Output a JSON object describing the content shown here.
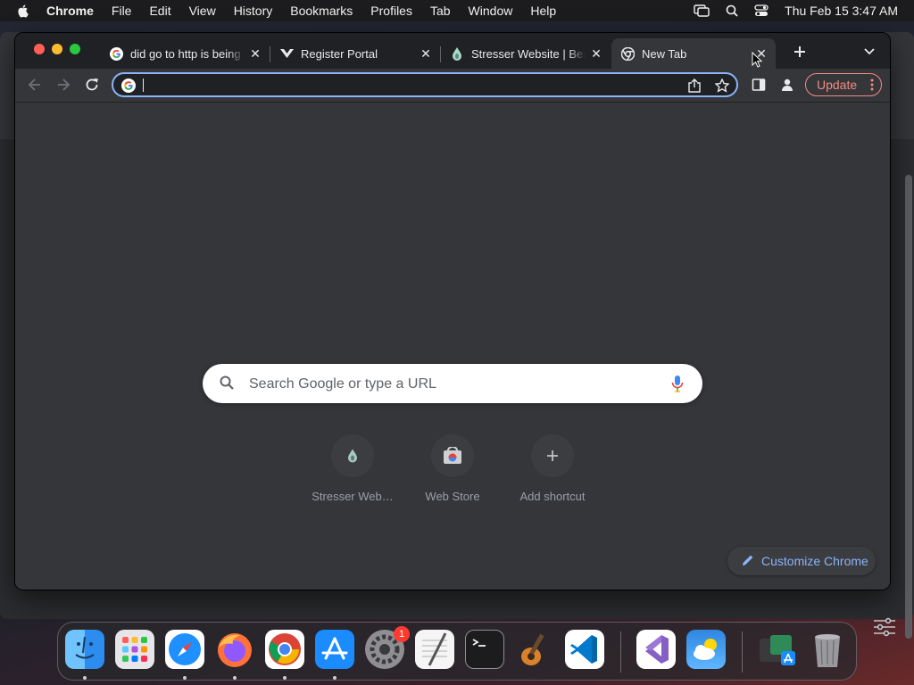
{
  "menubar": {
    "app_name": "Chrome",
    "items": [
      "File",
      "Edit",
      "View",
      "History",
      "Bookmarks",
      "Profiles",
      "Tab",
      "Window",
      "Help"
    ],
    "clock": "Thu Feb 15  3:47 AM"
  },
  "tabs": [
    {
      "title": "did go to http is being",
      "favicon": "google-icon",
      "active": false
    },
    {
      "title": "Register Portal",
      "favicon": "v-logo-icon",
      "active": false
    },
    {
      "title": "Stresser Website | Bes",
      "favicon": "droplet-icon",
      "active": false
    },
    {
      "title": "New Tab",
      "favicon": "chrome-icon",
      "active": true
    }
  ],
  "omnibox": {
    "value": "",
    "placeholder": ""
  },
  "toolbar": {
    "update_label": "Update"
  },
  "ntp": {
    "search_placeholder": "Search Google or type a URL",
    "shortcuts": [
      {
        "label": "Stresser Web…",
        "icon": "droplet-icon"
      },
      {
        "label": "Web Store",
        "icon": "web-store-icon"
      },
      {
        "label": "Add shortcut",
        "icon": "plus-icon"
      }
    ],
    "customize_label": "Customize Chrome"
  },
  "dock": {
    "apps": [
      "Finder",
      "Launchpad",
      "Safari",
      "Firefox",
      "Chrome",
      "App Store",
      "System Settings",
      "TextEdit",
      "Terminal",
      "GarageBand",
      "Visual Studio Code",
      "Visual Studio",
      "Weather",
      "Downloads",
      "Trash"
    ],
    "settings_badge": "1"
  },
  "colors": {
    "accent": "#8ab4f8",
    "update": "#f28b82",
    "tabstrip": "#202124",
    "surface": "#35363a"
  }
}
